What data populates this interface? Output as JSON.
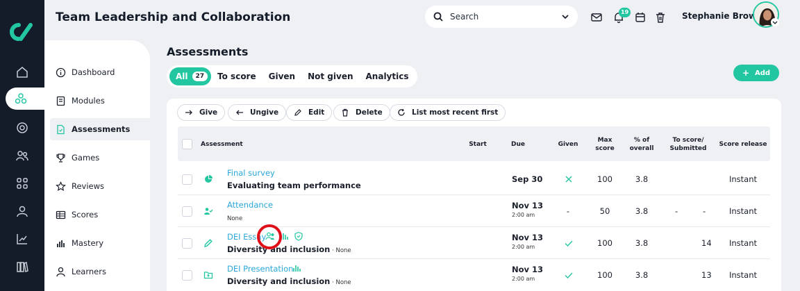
{
  "app_title": "Team Leadership and Collaboration",
  "search": {
    "placeholder": "Search"
  },
  "notifications_count": "19",
  "user_name": "Stephanie Brown",
  "colors": {
    "accent": "#22c6a1",
    "rail": "#141b29",
    "link": "#2ba7d9",
    "highlight": "#e0101b"
  },
  "rail_icons": [
    "home-icon",
    "hierarchy-icon",
    "target-icon",
    "people-icon",
    "grid-icon",
    "person-icon",
    "chart-line-icon",
    "books-icon"
  ],
  "sidebar": {
    "items": [
      {
        "label": "Dashboard",
        "icon": "info-icon"
      },
      {
        "label": "Modules",
        "icon": "book-icon"
      },
      {
        "label": "Assessments",
        "icon": "document-icon"
      },
      {
        "label": "Games",
        "icon": "trophy-icon"
      },
      {
        "label": "Reviews",
        "icon": "star-icon"
      },
      {
        "label": "Scores",
        "icon": "table-icon"
      },
      {
        "label": "Mastery",
        "icon": "bars-icon"
      },
      {
        "label": "Learners",
        "icon": "person-icon"
      }
    ]
  },
  "main": {
    "title": "Assessments",
    "tabs": [
      {
        "label": "All",
        "count": "27"
      },
      {
        "label": "To score"
      },
      {
        "label": "Given"
      },
      {
        "label": "Not given"
      },
      {
        "label": "Analytics"
      }
    ],
    "add_label": "Add",
    "actions": [
      "Give",
      "Ungive",
      "Edit",
      "Delete",
      "List most recent first"
    ]
  },
  "table": {
    "headers": {
      "assessment": "Assessment",
      "start": "Start",
      "due": "Due",
      "given": "Given",
      "max_score_1": "Max",
      "max_score_2": "score",
      "pct_1": "% of",
      "pct_2": "overall",
      "to_score_1": "To score/",
      "to_score_2": "Submitted",
      "release": "Score release"
    },
    "rows": [
      {
        "title": "Final survey",
        "subtitle": "Evaluating team performance",
        "subtitle_extra": "",
        "start": "",
        "due": "Sep 30",
        "due_time": "",
        "given": "cross",
        "max": "100",
        "pct": "3.8",
        "to_score": "",
        "submitted": "",
        "release": "Instant",
        "icon": "chart-pie-icon"
      },
      {
        "title": "Attendance",
        "subtitle": "",
        "subtitle_extra": "None",
        "start": "",
        "due": "Nov 13",
        "due_time": "2:00 am",
        "given": "-",
        "max": "50",
        "pct": "3.8",
        "to_score": "-",
        "submitted": "-",
        "release": "Instant",
        "icon": "people-check-icon"
      },
      {
        "title": "DEI Essay",
        "subtitle": "Diversity and inclusion",
        "subtitle_extra": " · None",
        "start": "",
        "due": "Nov 13",
        "due_time": "2:00 am",
        "given": "check",
        "max": "100",
        "pct": "3.8",
        "to_score": "",
        "submitted": "14",
        "release": "Instant",
        "icon": "pencil-icon"
      },
      {
        "title": "DEI Presentation",
        "subtitle": "Diversity and inclusion",
        "subtitle_extra": " · None",
        "start": "",
        "due": "Nov 13",
        "due_time": "2:00 am",
        "given": "check",
        "max": "100",
        "pct": "3.8",
        "to_score": "",
        "submitted": "13",
        "release": "Instant",
        "icon": "folder-upload-icon"
      }
    ]
  }
}
